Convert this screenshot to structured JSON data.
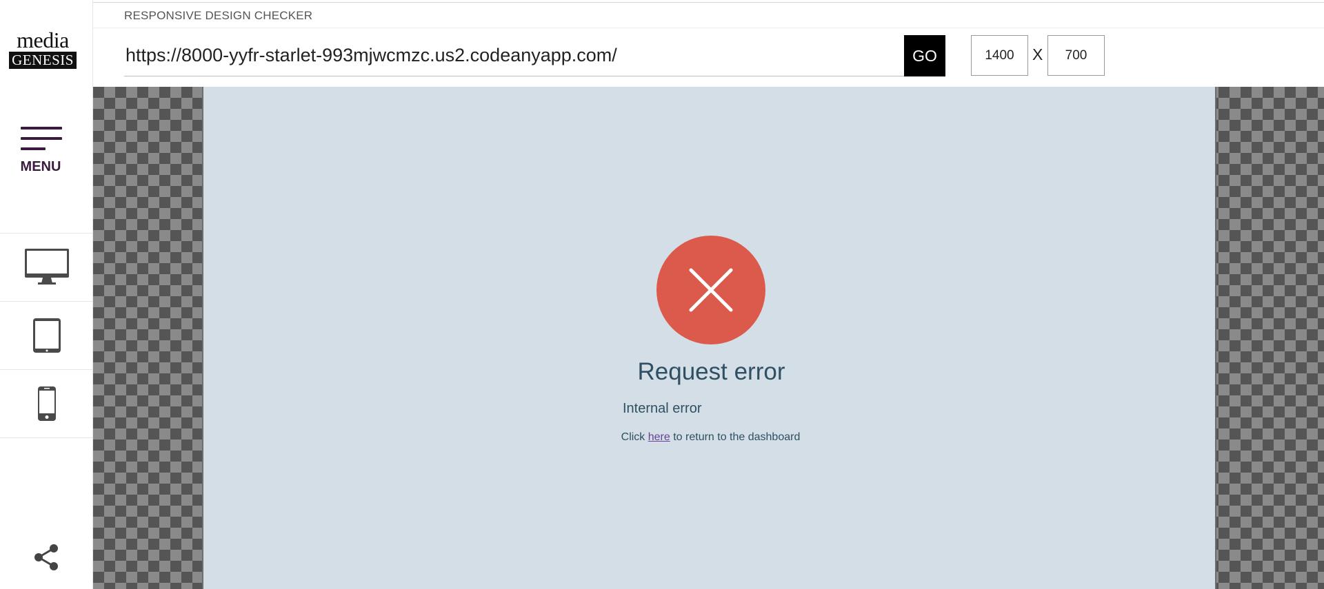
{
  "app": {
    "title": "RESPONSIVE DESIGN CHECKER",
    "logo_top": "media",
    "logo_bottom": "GENESIS"
  },
  "sidebar": {
    "menu_label": "MENU",
    "devices": [
      {
        "icon": "desktop-icon"
      },
      {
        "icon": "tablet-icon"
      },
      {
        "icon": "phone-icon"
      }
    ],
    "share_icon": "share-icon"
  },
  "toolbar": {
    "url": "https://8000-yyfr-starlet-993mjwcmzc.us2.codeanyapp.com/",
    "go_label": "GO",
    "width": "1400",
    "height": "700",
    "separator": "X"
  },
  "preview": {
    "error_icon": "close-icon",
    "error_title": "Request error",
    "error_message": "Internal error",
    "link_prefix": "Click ",
    "link_text": "here",
    "link_suffix": " to return to the dashboard"
  },
  "colors": {
    "accent": "#3a1a3e",
    "error": "#dc5a4b",
    "frame_bg": "#d3dee6",
    "link": "#6a3f97"
  }
}
